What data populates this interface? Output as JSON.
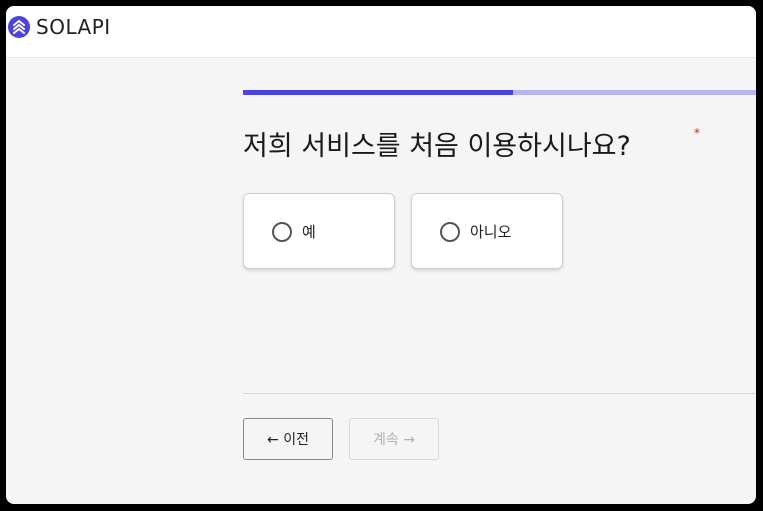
{
  "brand": {
    "name": "SOLAPI",
    "accent": "#4a43e0"
  },
  "progress": {
    "fraction": 0.52
  },
  "question": {
    "text": "저희 서비스를 처음 이용하시나요?",
    "required_mark": "*"
  },
  "options": [
    {
      "label": "예"
    },
    {
      "label": "아니오"
    }
  ],
  "nav": {
    "prev_label": "← 이전",
    "next_label": "계속 →"
  }
}
